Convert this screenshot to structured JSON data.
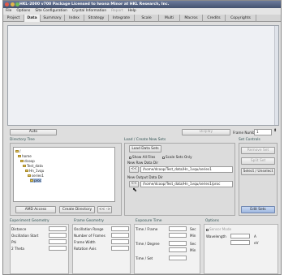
{
  "window": {
    "title": "HKL-2000 v700    Package Licensed to Iwona Minor at HKL Research, Inc."
  },
  "menu": [
    {
      "label": "File",
      "enabled": true
    },
    {
      "label": "Options",
      "enabled": true
    },
    {
      "label": "Site Configuration",
      "enabled": true
    },
    {
      "label": "Crystal Information",
      "enabled": true
    },
    {
      "label": "Report",
      "enabled": false
    },
    {
      "label": "Help",
      "enabled": true
    }
  ],
  "tabs": [
    "Project",
    "Data",
    "Summary",
    "Index",
    "Strategy",
    "Integrate",
    "Scale",
    "Multi",
    "Macros",
    "Credits",
    "Copyrights"
  ],
  "active_tab": "Data",
  "toolbar": {
    "auto": "Auto",
    "display": "Display",
    "frame_number_label": "Frame Number",
    "frame_number_value": "1"
  },
  "directory_tree": {
    "title": "Directory Tree",
    "nodes": [
      "/",
      "home",
      "dcoop",
      "Test_data",
      "Hn_1vqu",
      "series1",
      "proc"
    ],
    "amd_access": "AMD Access",
    "create_directory": "Create Directory",
    "nav": "<< ->"
  },
  "load_sets": {
    "title": "Load / Create New Sets",
    "load_data_sets": "Load Data Sets",
    "show_all_files": "Show All Files",
    "scale_sets_only": "Scale Sets Only",
    "new_raw_label": "New Raw Data Dir",
    "raw_btn": "<<",
    "raw_path": "/home/dcoop/Test_data/Hn_1vqu/series1",
    "new_output_label": "New Output Data Dir",
    "out_btn": "<<",
    "out_path": "/home/dcoop/Test_data/Hn_1vqu/series1/proc"
  },
  "set_controls": {
    "title": "Set Controls",
    "remove_set": "Remove Set",
    "split_set": "Split Set",
    "select_unselect": "Select / Unselect",
    "edit_sets": "Edit Sets"
  },
  "experiment_geometry": {
    "title": "Experiment Geometry",
    "rows": [
      "Distance",
      "Oscillation Start",
      "Phi",
      "2 Theta"
    ]
  },
  "frame_geometry": {
    "title": "Frame Geometry",
    "rows": [
      "Oscillation Range",
      "Number of Frames",
      "Frame Width",
      "Rotation Axis"
    ]
  },
  "exposure_time": {
    "title": "Exposure Time",
    "rows": [
      {
        "label": "Time / Frame",
        "unit": "Sec"
      },
      {
        "label": "",
        "unit": "Min"
      },
      {
        "label": "Time / Degree",
        "unit": "Sec"
      },
      {
        "label": "",
        "unit": "Min"
      },
      {
        "label": "Time / Set",
        "unit": ""
      }
    ]
  },
  "options": {
    "title": "Options",
    "sensor_label": "Sensor Mode",
    "wavelength_label": "Wavelength",
    "unit_a": "A",
    "unit_ev": "eV"
  },
  "colors": {
    "titlebar": "#44526f",
    "selection": "#9bb7e0",
    "edit_button": "#9fb8e0"
  }
}
